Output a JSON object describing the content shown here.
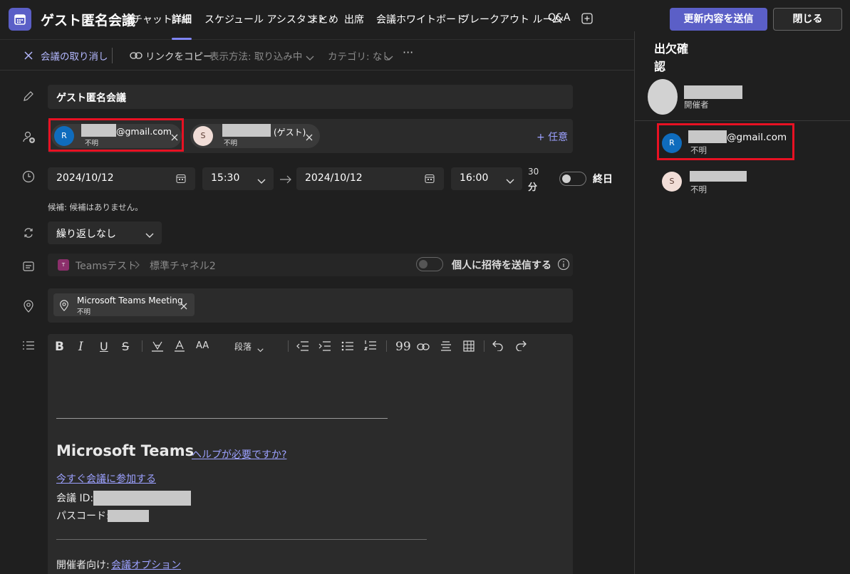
{
  "header": {
    "title": "ゲスト匿名会議",
    "tabs": [
      {
        "label": "チャット"
      },
      {
        "label": "詳細"
      },
      {
        "label": "スケジュール アシスタント"
      },
      {
        "label": "まとめ"
      },
      {
        "label": "出席"
      },
      {
        "label": "会議ホワイトボード"
      },
      {
        "label": "ブレークアウト ルーム"
      },
      {
        "label": "Q&A"
      }
    ],
    "send_update_label": "更新内容を送信",
    "close_label": "閉じる"
  },
  "toolbar": {
    "cancel_label": "会議の取り消し",
    "copy_link_label": "リンクをコピー",
    "display_label": "表示方法: 取り込み中",
    "category_label": "カテゴリ: なし",
    "more": "···"
  },
  "form": {
    "title_value": "ゲスト匿名会議",
    "attendees": [
      {
        "initial": "R",
        "email_suffix": "@gmail.com",
        "status": "不明"
      },
      {
        "initial": "S",
        "suffix": "(ゲスト)",
        "status": "不明"
      }
    ],
    "optional_label": "+ 任意",
    "start_date": "2024/10/12",
    "start_time": "15:30",
    "end_date": "2024/10/12",
    "end_time": "16:00",
    "duration_number": "30",
    "duration_unit": "分",
    "allday_label": "終日",
    "suggestion_text": "候補: 候補はありません。",
    "repeat_value": "繰り返しなし",
    "channel_team": "Teamsテスト",
    "channel_name": "標準チャネル2",
    "send_invite_label": "個人に招待を送信する",
    "location_name": "Microsoft Teams Meeting",
    "location_status": "不明",
    "paragraph_label": "段落"
  },
  "body": {
    "teams_heading": "Microsoft Teams",
    "help_link": "ヘルプが必要ですか?",
    "join_link": "今すぐ会議に参加する",
    "meeting_id_label": "会議 ID:",
    "passcode_label": "パスコード:",
    "organizer_label": "開催者向け:",
    "options_link": "会議オプション"
  },
  "rsvp": {
    "title_line1": "出欠確",
    "title_line2": "認",
    "organizer_role": "開催者",
    "people": [
      {
        "initial": "R",
        "email_suffix": "@gmail.com",
        "status": "不明"
      },
      {
        "initial": "S",
        "status": "不明"
      }
    ]
  },
  "colors": {
    "accent": "#5b5fc7",
    "link": "#9ca1ff",
    "highlight": "#e81123",
    "background": "#1f1f1f",
    "field": "#2b2b2b"
  }
}
